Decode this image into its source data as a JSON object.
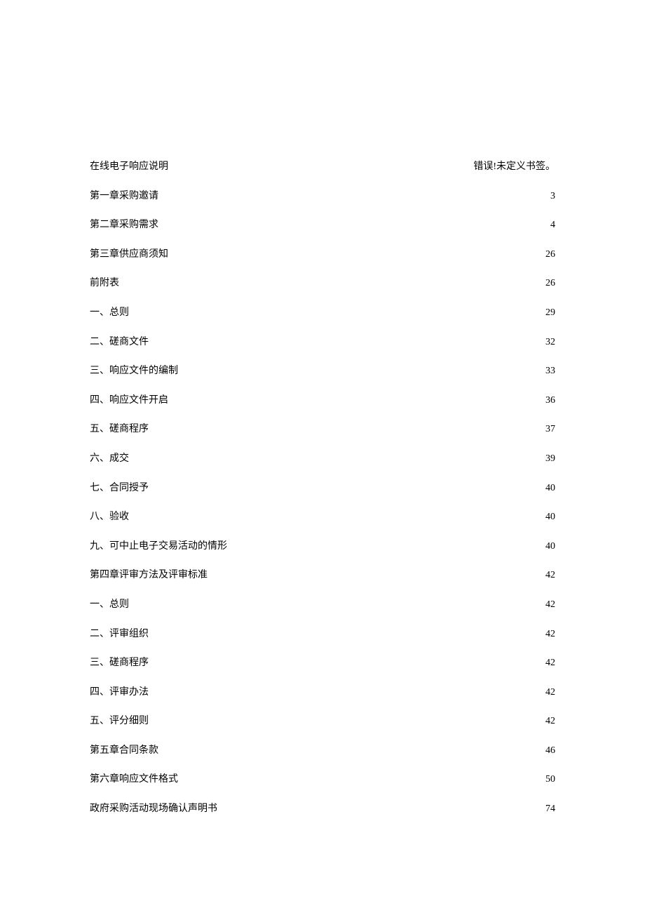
{
  "toc": {
    "entries": [
      {
        "title": "在线电子响应说明",
        "page": "错误!未定义书签。"
      },
      {
        "title": "第一章采购邀请",
        "page": "3"
      },
      {
        "title": "第二章采购需求",
        "page": "4"
      },
      {
        "title": "第三章供应商须知",
        "page": "26"
      },
      {
        "title": "前附表",
        "page": "26"
      },
      {
        "title": "一、总则",
        "page": "29"
      },
      {
        "title": "二、磋商文件",
        "page": "32"
      },
      {
        "title": "三、响应文件的编制",
        "page": "33"
      },
      {
        "title": "四、响应文件开启",
        "page": "36"
      },
      {
        "title": "五、磋商程序",
        "page": "37"
      },
      {
        "title": "六、成交",
        "page": "39"
      },
      {
        "title": "七、合同授予",
        "page": "40"
      },
      {
        "title": "八、验收",
        "page": "40"
      },
      {
        "title": "九、可中止电子交易活动的情形",
        "page": "40"
      },
      {
        "title": "第四章评审方法及评审标准",
        "page": "42"
      },
      {
        "title": "一、总则",
        "page": "42"
      },
      {
        "title": "二、评审组织",
        "page": "42"
      },
      {
        "title": "三、磋商程序",
        "page": "42"
      },
      {
        "title": "四、评审办法",
        "page": "42"
      },
      {
        "title": "五、评分细则",
        "page": "42"
      },
      {
        "title": "第五章合同条款",
        "page": "46"
      },
      {
        "title": "第六章响应文件格式",
        "page": "50"
      },
      {
        "title": "政府采购活动现场确认声明书",
        "page": "74"
      }
    ]
  }
}
